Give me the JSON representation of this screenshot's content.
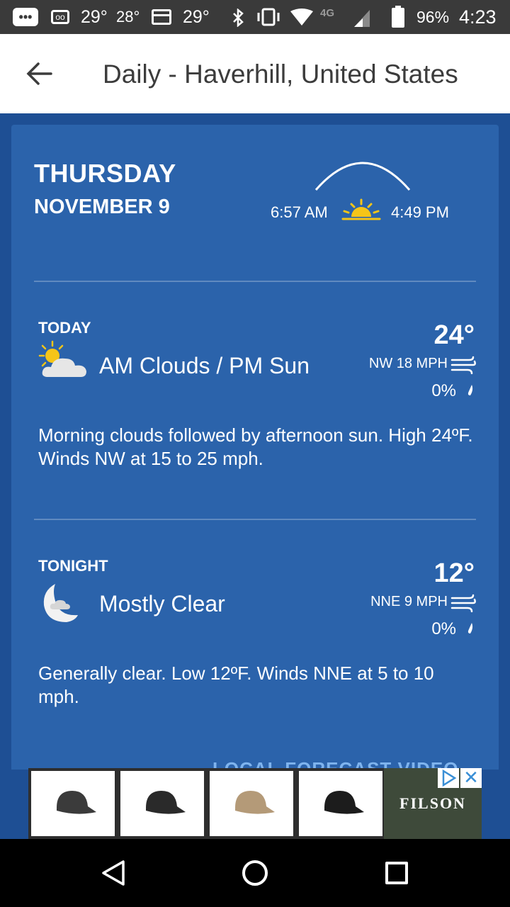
{
  "status_bar": {
    "temps": [
      "29°",
      "28°",
      "29°"
    ],
    "network": "4G",
    "battery": "96%",
    "time": "4:23"
  },
  "app_bar": {
    "title": "Daily - Haverhill, United States"
  },
  "day": {
    "name": "THURSDAY",
    "date": "NOVEMBER 9",
    "sunrise": "6:57 AM",
    "sunset": "4:49 PM"
  },
  "periods": [
    {
      "label": "TODAY",
      "icon": "partly-sunny-icon",
      "condition": "AM Clouds / PM Sun",
      "temp": "24°",
      "wind": "NW 18 MPH",
      "precip": "0%",
      "description": "Morning clouds followed by afternoon sun. High 24ºF. Winds NW at 15 to 25 mph."
    },
    {
      "label": "TONIGHT",
      "icon": "moon-cloud-icon",
      "condition": "Mostly Clear",
      "temp": "12°",
      "wind": "NNE 9 MPH",
      "precip": "0%",
      "description": "Generally clear. Low 12ºF. Winds NNE at 5 to 10 mph."
    }
  ],
  "video_link": "LOCAL FORECAST VIDEO",
  "ad": {
    "brand": "FILSON",
    "close": "✕"
  },
  "colors": {
    "card": "#2b63ab",
    "background": "#1e4f94",
    "link": "#7fb4ee"
  }
}
